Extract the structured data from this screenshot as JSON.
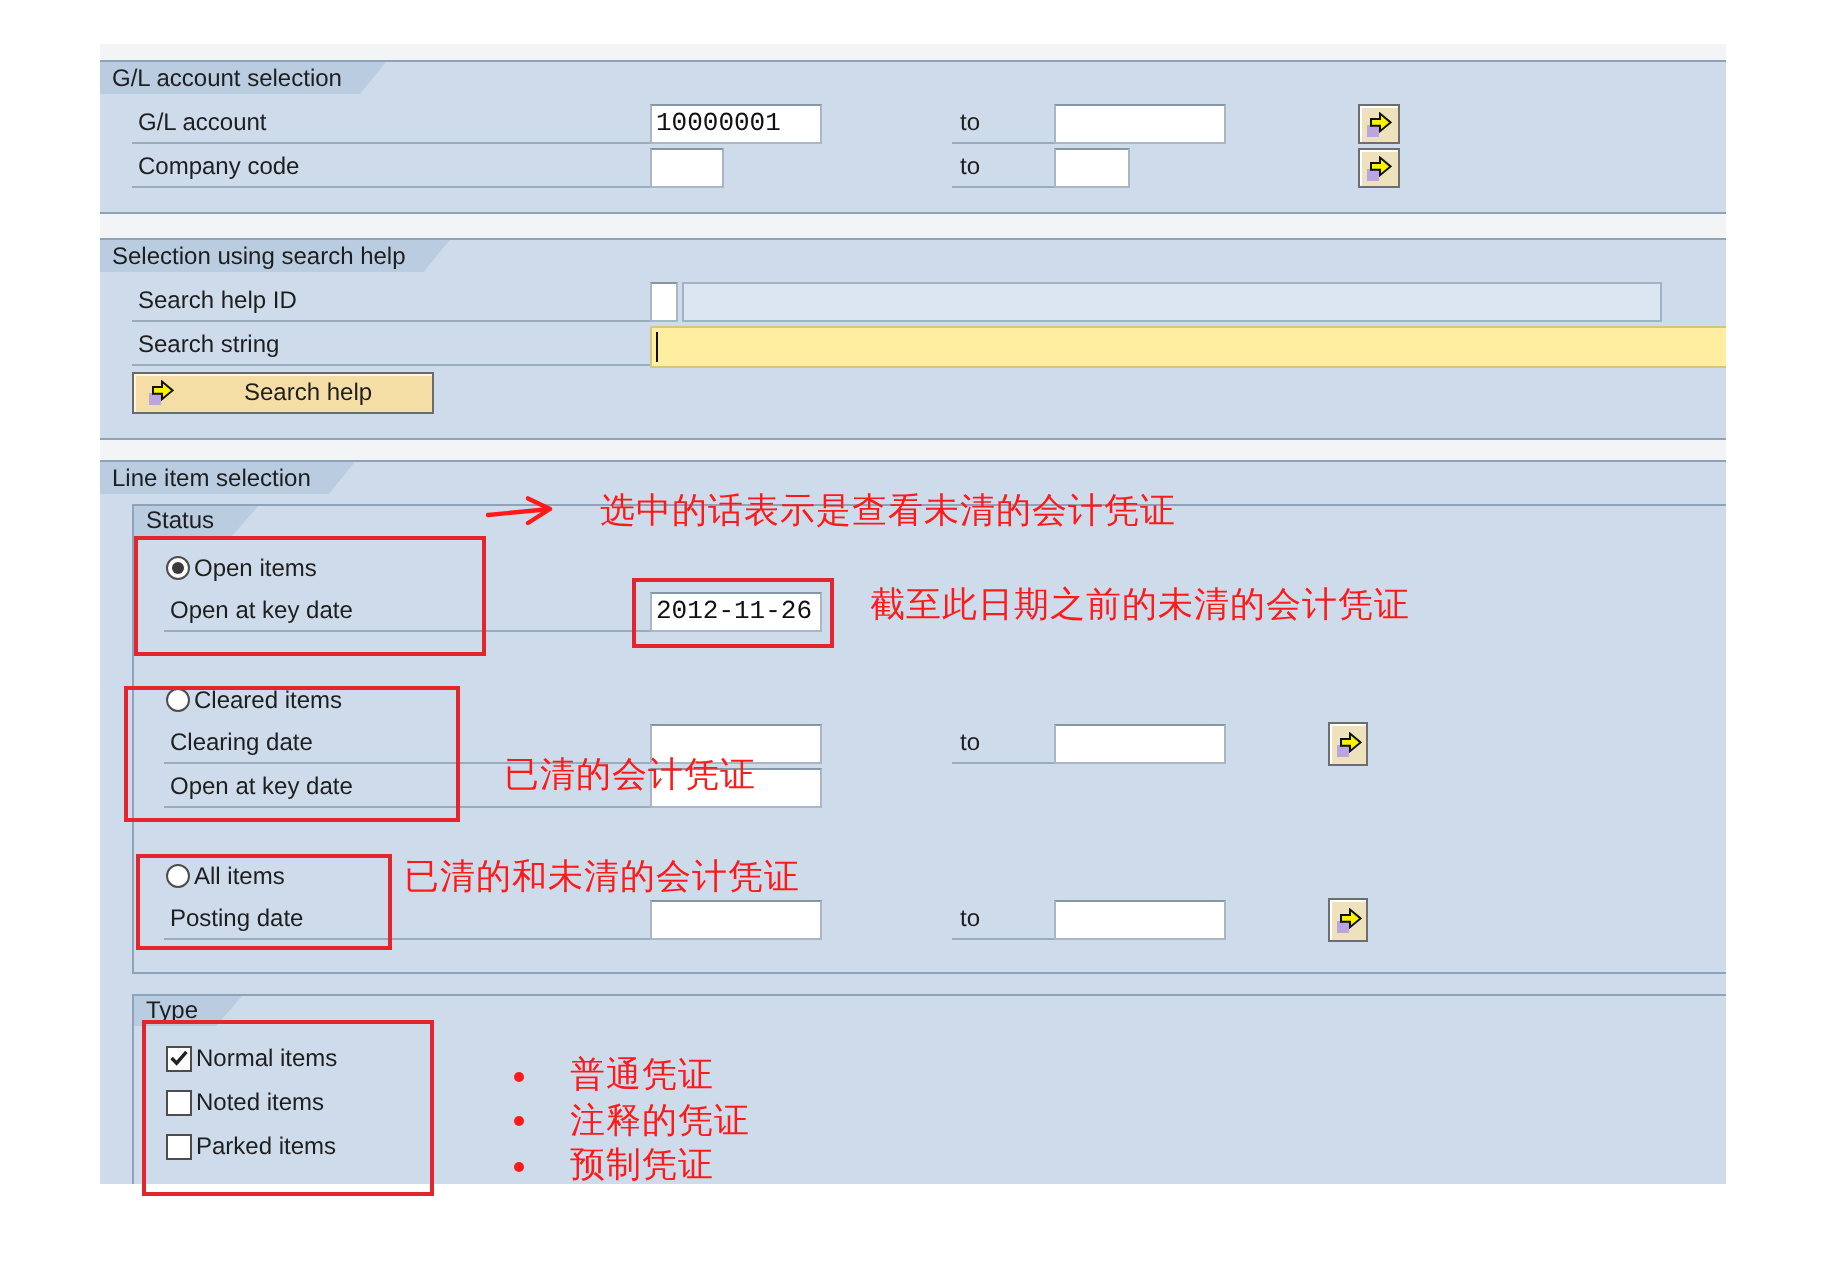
{
  "gl_account_selection": {
    "title": "G/L account selection",
    "rows": [
      {
        "label": "G/L account",
        "value": "10000001",
        "to_label": "to"
      },
      {
        "label": "Company code",
        "to_label": "to"
      }
    ]
  },
  "search_help_selection": {
    "title": "Selection using search help",
    "search_help_id": {
      "label": "Search help ID"
    },
    "search_string": {
      "label": "Search string",
      "focused": true
    },
    "button": "Search help"
  },
  "line_item_selection": {
    "title": "Line item selection",
    "status": {
      "title": "Status",
      "options": [
        {
          "label": "Open items",
          "selected": true,
          "fields": [
            {
              "label": "Open at key date",
              "value": "2012-11-26"
            }
          ]
        },
        {
          "label": "Cleared items",
          "selected": false,
          "fields": [
            {
              "label": "Clearing date",
              "to_label": "to"
            },
            {
              "label": "Open at key date"
            }
          ]
        },
        {
          "label": "All items",
          "selected": false,
          "fields": [
            {
              "label": "Posting date",
              "to_label": "to"
            }
          ]
        }
      ]
    },
    "type": {
      "title": "Type",
      "items": [
        {
          "label": "Normal items",
          "checked": true
        },
        {
          "label": "Noted items",
          "checked": false
        },
        {
          "label": "Parked items",
          "checked": false
        }
      ]
    }
  },
  "annotations": {
    "notes": [
      "选中的话表示是查看未清的会计凭证",
      "截至此日期之前的未清的会计凭证",
      "已清的会计凭证",
      "已清的和未清的会计凭证"
    ],
    "type_notes": [
      "普通凭证",
      "注释的凭证",
      "预制凭证"
    ]
  }
}
